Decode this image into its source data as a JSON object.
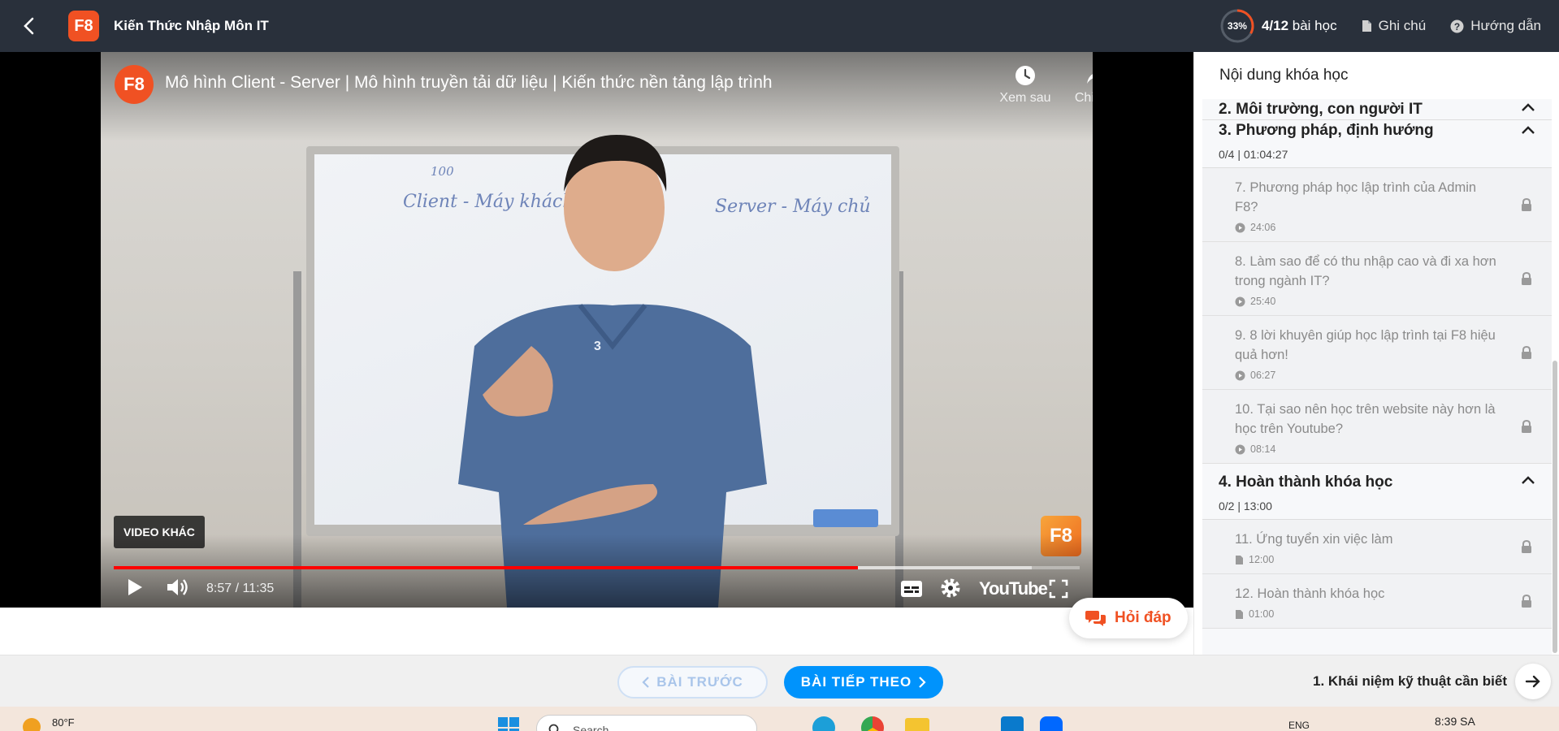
{
  "header": {
    "logo_text": "F8",
    "course_title": "Kiến Thức Nhập Môn IT",
    "progress_percent_label": "33%",
    "progress_fraction": 0.33,
    "lessons_count": "4/12",
    "lessons_label": "bài học",
    "notes_label": "Ghi chú",
    "guide_label": "Hướng dẫn"
  },
  "video": {
    "channel_logo": "F8",
    "title": "Mô hình Client - Server | Mô hình truyền tải dữ liệu | Kiến thức nền tảng lập trình",
    "watch_later": "Xem sau",
    "share": "Chia sẻ",
    "more_videos": "VIDEO KHÁC",
    "watermark": "F8",
    "time_display": "8:57 / 11:35",
    "played_fraction": 0.77,
    "buffered_fraction": 0.95,
    "youtube_label": "YouTube",
    "board_text": [
      "100",
      "Client - Máy khách",
      "Server - Máy chủ"
    ],
    "shirt_number": "3"
  },
  "sidebar": {
    "title": "Nội dung khóa học",
    "sections": [
      {
        "title": "2. Môi trường, con người IT",
        "meta": ""
      },
      {
        "title": "3. Phương pháp, định hướng",
        "meta": "0/4 | 01:04:27",
        "lessons": [
          {
            "title": "7. Phương pháp học lập trình của Admin F8?",
            "duration": "24:06",
            "type": "video"
          },
          {
            "title": "8. Làm sao để có thu nhập cao và đi xa hơn trong ngành IT?",
            "duration": "25:40",
            "type": "video"
          },
          {
            "title": "9. 8 lời khuyên giúp học lập trình tại F8 hiệu quả hơn!",
            "duration": "06:27",
            "type": "video"
          },
          {
            "title": "10. Tại sao nên học trên website này hơn là học trên Youtube?",
            "duration": "08:14",
            "type": "video"
          }
        ]
      },
      {
        "title": "4. Hoàn thành khóa học",
        "meta": "0/2 | 13:00",
        "lessons": [
          {
            "title": "11. Ứng tuyển xin việc làm",
            "duration": "12:00",
            "type": "doc"
          },
          {
            "title": "12. Hoàn thành khóa học",
            "duration": "01:00",
            "type": "doc"
          }
        ]
      }
    ]
  },
  "qa_button": "Hỏi đáp",
  "bottom_nav": {
    "prev_label": "BÀI TRƯỚC",
    "next_label": "BÀI TIẾP THEO",
    "next_lesson_title": "1. Khái niệm kỹ thuật cần biết"
  },
  "taskbar": {
    "temperature": "80°F",
    "search_placeholder": "Search",
    "language": "ENG",
    "clock": "8:39 SA"
  },
  "colors": {
    "header_bg": "#29303b",
    "brand_orange": "#f05123",
    "primary_blue": "#0093fc",
    "progress_red": "#ff0000"
  }
}
